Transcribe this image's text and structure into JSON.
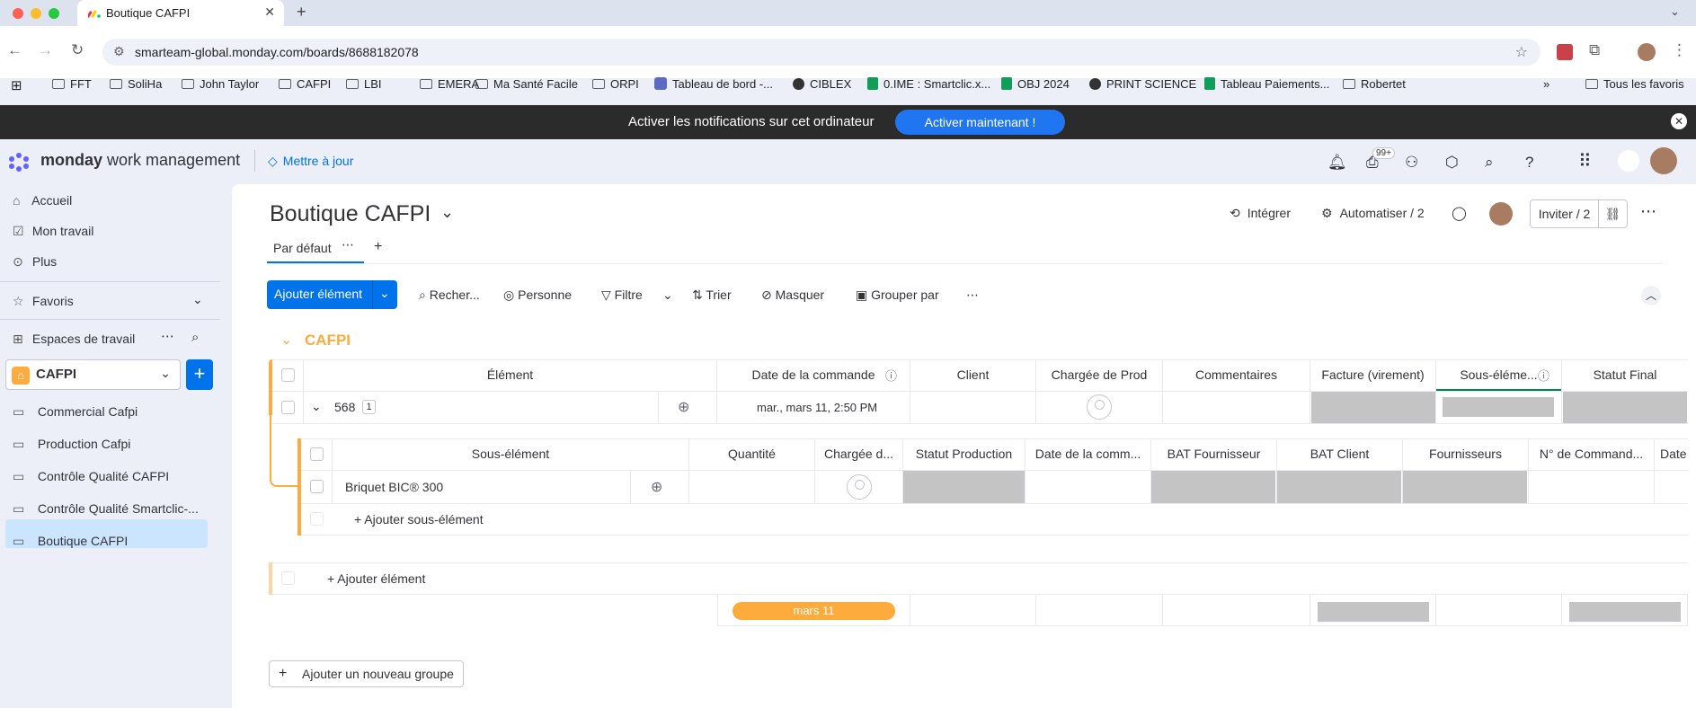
{
  "browser": {
    "tab_title": "Boutique CAFPI",
    "url": "smarteam-global.monday.com/boards/8688182078",
    "bookmarks": [
      "FFT",
      "SoliHa",
      "John Taylor",
      "CAFPI",
      "LBI",
      "EMERA",
      "Ma Santé Facile",
      "ORPI",
      "Tableau de bord -...",
      "CIBLEX",
      "0.IME : Smartclic.x...",
      "OBJ 2024",
      "PRINT SCIENCE",
      "Tableau Paiements...",
      "Robertet"
    ],
    "more_bookmarks": "»",
    "all_favorites": "Tous les favoris"
  },
  "notification": {
    "message": "Activer les notifications sur cet ordinateur",
    "button": "Activer maintenant !"
  },
  "header": {
    "brand_bold": "monday",
    "brand_rest": " work management",
    "upgrade": "Mettre à jour",
    "badge": "99+"
  },
  "sidebar": {
    "home": "Accueil",
    "my_work": "Mon travail",
    "more": "Plus",
    "favorites": "Favoris",
    "workspaces": "Espaces de travail",
    "workspace_name": "CAFPI",
    "workspace_initial": "⌂",
    "boards": [
      "Commercial Cafpi",
      "Production Cafpi",
      "Contrôle Qualité CAFPI",
      "Contrôle Qualité Smartclic-...",
      "Boutique CAFPI"
    ]
  },
  "board": {
    "title": "Boutique CAFPI",
    "integrate": "Intégrer",
    "automate": "Automatiser / 2",
    "invite": "Inviter / 2",
    "view_tab": "Par défaut",
    "add_item": "Ajouter élément",
    "search": "Recher...",
    "person": "Personne",
    "filter": "Filtre",
    "sort": "Trier",
    "hide": "Masquer",
    "group_by": "Grouper par",
    "group_name": "CAFPI",
    "columns": [
      "Élément",
      "Date de la commande",
      "Client",
      "Chargée de Prod",
      "Commentaires",
      "Facture (virement)",
      "Sous-éléme...",
      "Statut Final"
    ],
    "item": {
      "name": "568",
      "subitem_count": "1",
      "date": "mar., mars 11, 2:50 PM"
    },
    "subitem_columns": [
      "Sous-élément",
      "Quantité",
      "Chargée d...",
      "Statut Production",
      "Date de la comm...",
      "BAT Fournisseur",
      "BAT Client",
      "Fournisseurs",
      "N° de Command...",
      "Date"
    ],
    "subitem": {
      "name": "Briquet BIC® 300"
    },
    "add_subitem": "+ Ajouter sous-élément",
    "add_element": "+ Ajouter élément",
    "summary_date": "mars 11",
    "add_group": "Ajouter un nouveau groupe",
    "colors": {
      "group": "#fdab3d",
      "primary": "#0073ea"
    }
  }
}
